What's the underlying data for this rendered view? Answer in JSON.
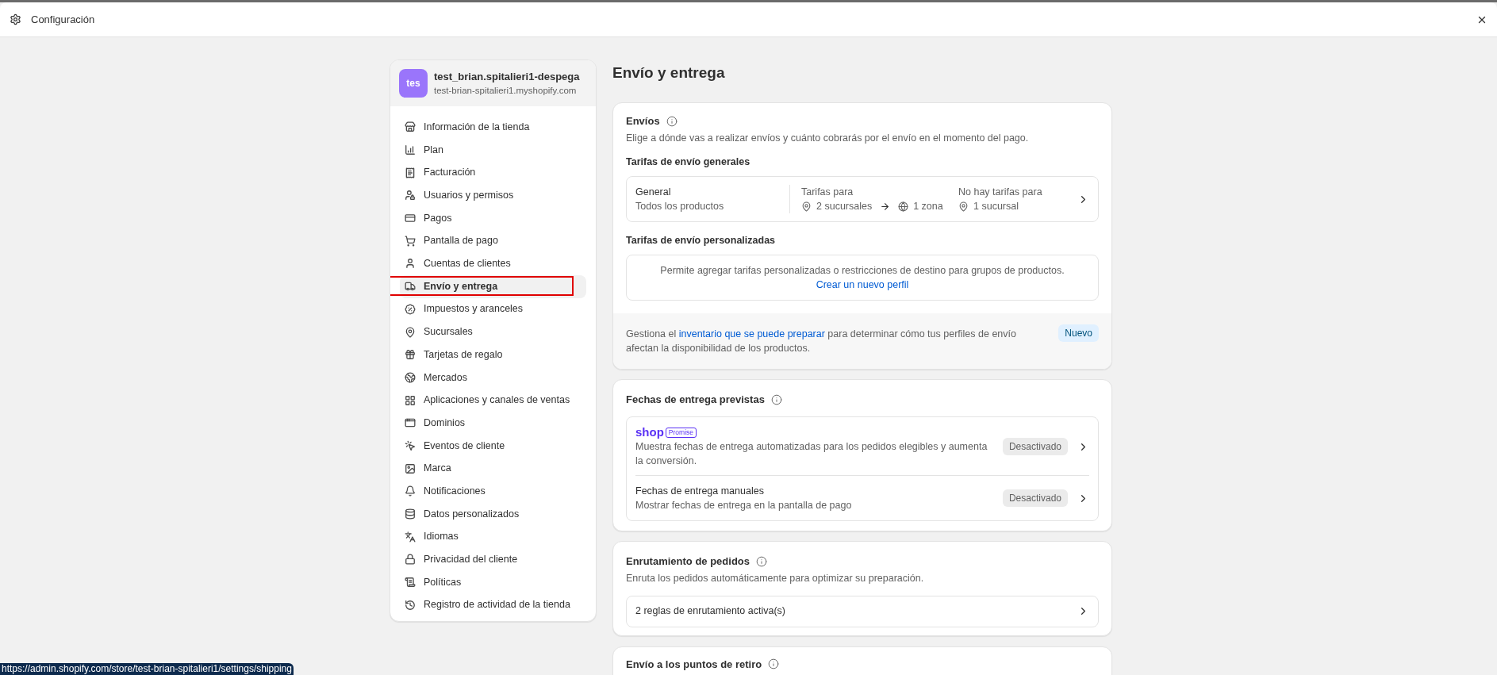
{
  "window": {
    "title": "Configuración"
  },
  "store": {
    "avatar": "tes",
    "name": "test_brian.spitalieri1-despega",
    "domain": "test-brian-spitalieri1.myshopify.com"
  },
  "sidebar": {
    "items": [
      {
        "label": "Información de la tienda",
        "selected": false
      },
      {
        "label": "Plan",
        "selected": false
      },
      {
        "label": "Facturación",
        "selected": false
      },
      {
        "label": "Usuarios y permisos",
        "selected": false
      },
      {
        "label": "Pagos",
        "selected": false
      },
      {
        "label": "Pantalla de pago",
        "selected": false
      },
      {
        "label": "Cuentas de clientes",
        "selected": false
      },
      {
        "label": "Envío y entrega",
        "selected": true
      },
      {
        "label": "Impuestos y aranceles",
        "selected": false
      },
      {
        "label": "Sucursales",
        "selected": false
      },
      {
        "label": "Tarjetas de regalo",
        "selected": false
      },
      {
        "label": "Mercados",
        "selected": false
      },
      {
        "label": "Aplicaciones y canales de ventas",
        "selected": false
      },
      {
        "label": "Dominios",
        "selected": false
      },
      {
        "label": "Eventos de cliente",
        "selected": false
      },
      {
        "label": "Marca",
        "selected": false
      },
      {
        "label": "Notificaciones",
        "selected": false
      },
      {
        "label": "Datos personalizados",
        "selected": false
      },
      {
        "label": "Idiomas",
        "selected": false
      },
      {
        "label": "Privacidad del cliente",
        "selected": false
      },
      {
        "label": "Políticas",
        "selected": false
      },
      {
        "label": "Registro de actividad de la tienda",
        "selected": false
      }
    ]
  },
  "page_title": "Envío y entrega",
  "shipping": {
    "title": "Envíos",
    "description": "Elige a dónde vas a realizar envíos y cuánto cobrarás por el envío en el momento del pago.",
    "general_heading": "Tarifas de envío generales",
    "general_profile": {
      "name": "General",
      "products": "Todos los productos",
      "rates_label": "Tarifas para",
      "origins": "2 sucursales",
      "zones": "1 zona",
      "no_rates_label": "No hay tarifas para",
      "excluded": "1 sucursal"
    },
    "custom_heading": "Tarifas de envío personalizadas",
    "custom_empty": {
      "text": "Permite agregar tarifas personalizadas o restricciones de destino para grupos de productos.",
      "link": "Crear un nuevo perfil"
    },
    "footer": {
      "before": "Gestiona el ",
      "link": "inventario que se puede preparar",
      "after": " para determinar cómo tus perfiles de envío afectan la disponibilidad de los productos.",
      "badge": "Nuevo"
    }
  },
  "delivery_dates": {
    "title": "Fechas de entrega previstas",
    "rows": [
      {
        "kind": "shop_promise",
        "logo": "shop",
        "logo_tag": "Promise",
        "description": "Muestra fechas de entrega automatizadas para los pedidos elegibles y aumenta la conversión.",
        "status": "Desactivado"
      },
      {
        "kind": "manual",
        "title": "Fechas de entrega manuales",
        "description": "Mostrar fechas de entrega en la pantalla de pago",
        "status": "Desactivado"
      }
    ]
  },
  "order_routing": {
    "title": "Enrutamiento de pedidos",
    "description": "Enruta los pedidos automáticamente para optimizar su preparación.",
    "rules": "2 reglas de enrutamiento activa(s)"
  },
  "pickup": {
    "title": "Envío a los puntos de retiro"
  },
  "status_url": "https://admin.shopify.com/store/test-brian-spitalieri1/settings/shipping"
}
